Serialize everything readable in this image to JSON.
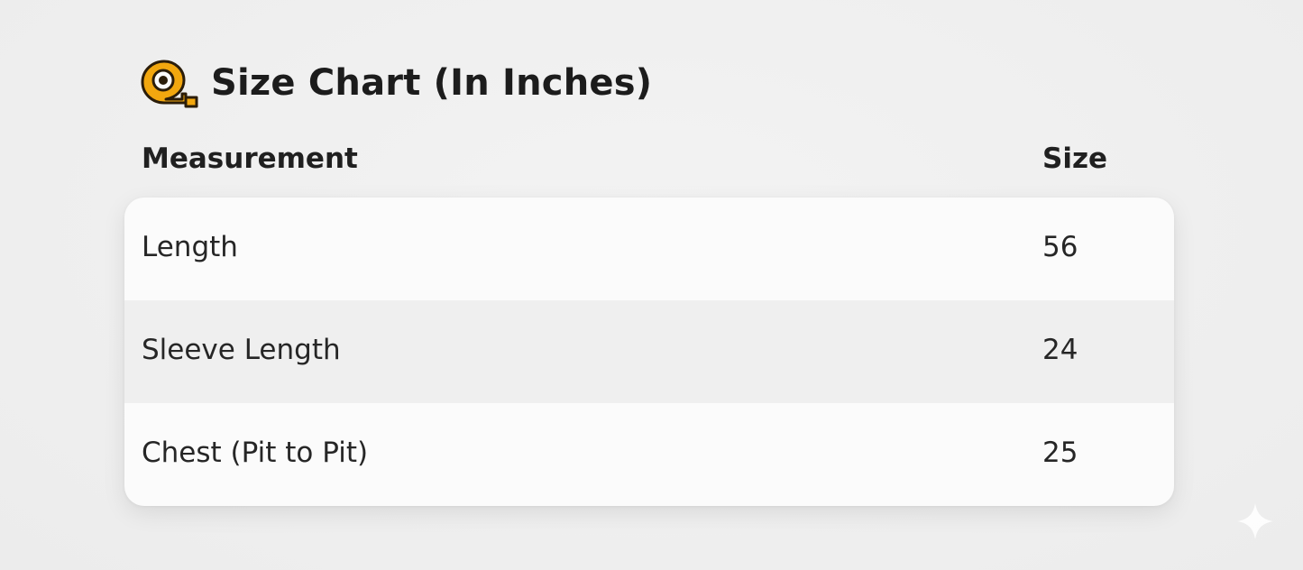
{
  "title": {
    "icon": "tape-measure-icon",
    "text": "Size Chart (In Inches)"
  },
  "table": {
    "headers": {
      "measurement": "Measurement",
      "size": "Size"
    },
    "rows": [
      {
        "measurement": "Length",
        "size": "56"
      },
      {
        "measurement": "Sleeve Length",
        "size": "24"
      },
      {
        "measurement": "Chest (Pit to Pit)",
        "size": "25"
      }
    ]
  },
  "colors": {
    "icon_accent": "#f2a70f",
    "background": "#efefef",
    "card": "#fbfbfb",
    "alt_row": "#efefef"
  },
  "watermark": {
    "icon": "sparkle-icon"
  }
}
